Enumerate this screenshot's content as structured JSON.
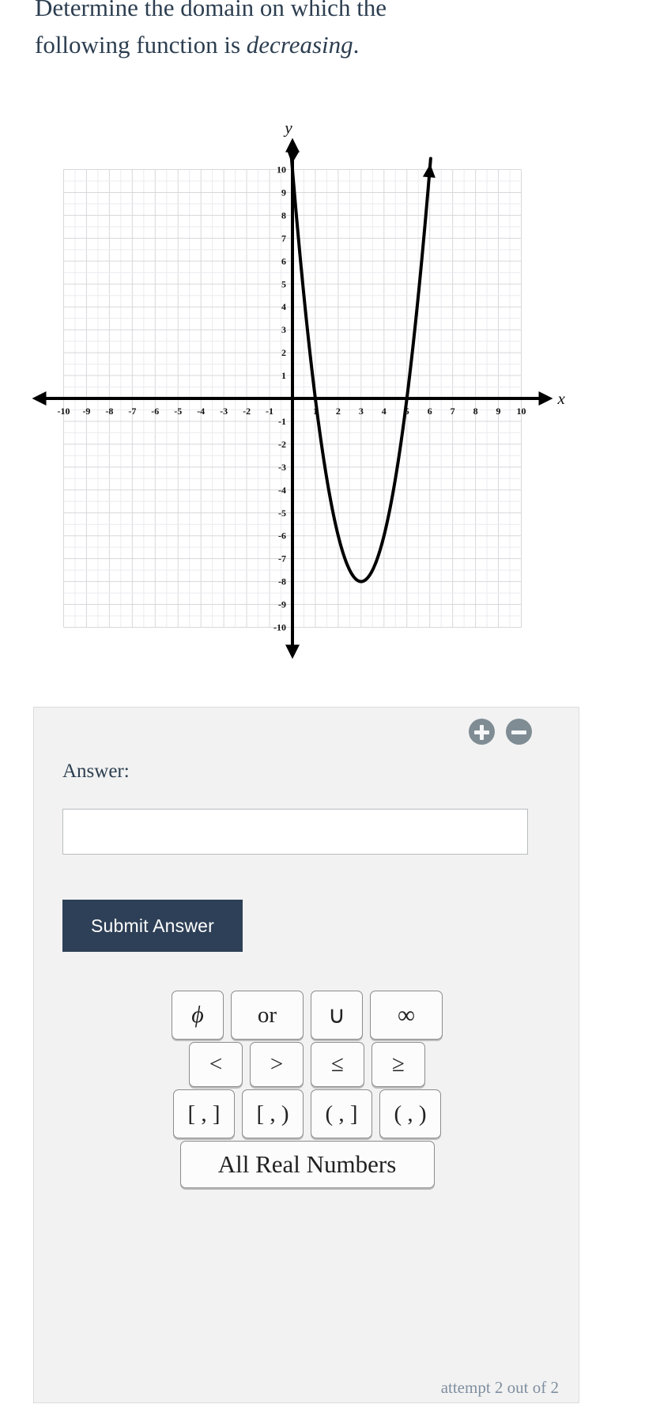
{
  "question": {
    "line1": "Determine the domain on which the",
    "line2_prefix": "following function is ",
    "line2_emphasis": "decreasing",
    "line2_suffix": "."
  },
  "chart_data": {
    "type": "line",
    "title": "",
    "xlabel": "x",
    "ylabel": "y",
    "xlim": [
      -10,
      10
    ],
    "ylim": [
      -10,
      10
    ],
    "grid": true,
    "legend": null,
    "x_ticks": [
      -10,
      -9,
      -8,
      -7,
      -6,
      -5,
      -4,
      -3,
      -2,
      -1,
      1,
      2,
      3,
      4,
      5,
      6,
      7,
      8,
      9,
      10
    ],
    "y_ticks": [
      10,
      9,
      8,
      7,
      6,
      5,
      4,
      3,
      2,
      1,
      -1,
      -2,
      -3,
      -4,
      -5,
      -6,
      -7,
      -8,
      -9,
      -10
    ],
    "x_tick_labels": [
      "-10",
      "-9",
      "-8",
      "-7",
      "-6",
      "-5",
      "-4",
      "-3",
      "-2",
      "-1",
      "1",
      "2",
      "3",
      "4",
      "5",
      "6",
      "7",
      "8",
      "9",
      "10"
    ],
    "y_tick_labels": [
      "10",
      "9",
      "8",
      "7",
      "6",
      "5",
      "4",
      "3",
      "2",
      "1",
      "-1",
      "-2",
      "-3",
      "-4",
      "-5",
      "-6",
      "-7",
      "-8",
      "-9",
      "-10"
    ],
    "series": [
      {
        "name": "parabola",
        "equation": "y = 2(x-3)^2 - 8",
        "color": "#000000",
        "vertex": [
          3,
          -8
        ],
        "roots": [
          1,
          5
        ],
        "y_intercept": 10,
        "x": [
          0.0,
          0.25,
          0.5,
          0.75,
          1.0,
          1.25,
          1.5,
          1.75,
          2.0,
          2.25,
          2.5,
          2.75,
          3.0,
          3.25,
          3.5,
          3.75,
          4.0,
          4.25,
          4.5,
          4.75,
          5.0,
          5.25,
          5.5,
          5.75,
          6.0
        ],
        "y": [
          10.0,
          7.125,
          4.5,
          2.125,
          0.0,
          -1.875,
          -3.5,
          -4.875,
          -6.0,
          -6.875,
          -7.5,
          -7.875,
          -8.0,
          -7.875,
          -7.5,
          -6.875,
          -6.0,
          -4.875,
          -3.5,
          -1.875,
          0.0,
          2.125,
          4.5,
          7.125,
          10.0
        ]
      }
    ]
  },
  "answer_panel": {
    "label": "Answer:",
    "input_value": "",
    "input_placeholder": "",
    "submit_label": "Submit Answer",
    "zoom_in_icon": "plus-circle-icon",
    "zoom_out_icon": "minus-circle-icon",
    "keypad": {
      "row1": [
        "ϕ",
        "or",
        "∪",
        "∞"
      ],
      "row2": [
        "<",
        ">",
        "≤",
        "≥"
      ],
      "row3": [
        "[ , ]",
        "[ , )",
        "( , ]",
        "( , )"
      ],
      "row4": [
        "All Real Numbers"
      ]
    },
    "attempt_text": "attempt 2 out of 2"
  }
}
